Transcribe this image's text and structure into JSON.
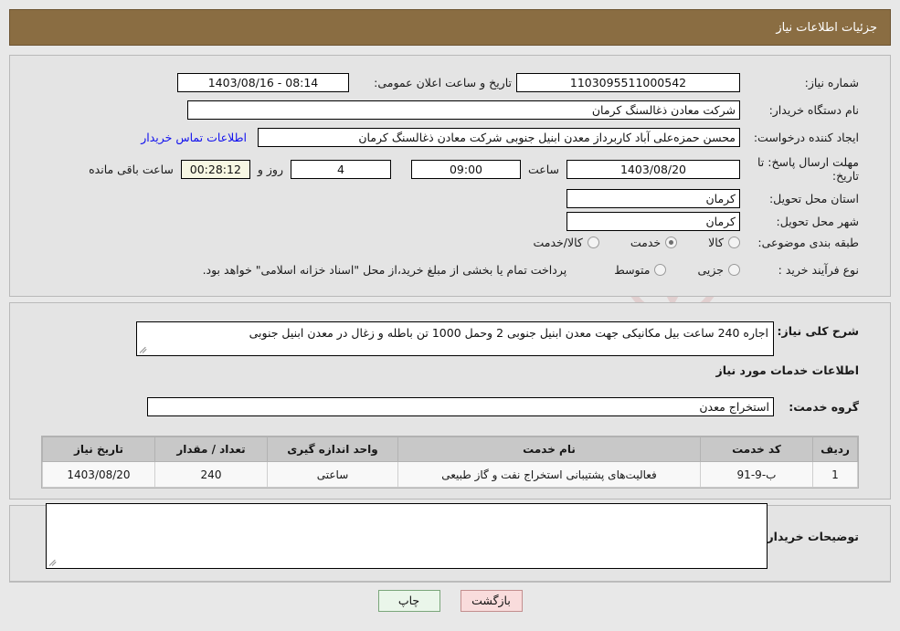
{
  "header": {
    "title": "جزئیات اطلاعات نیاز"
  },
  "watermark": {
    "text": "AriaTender.net"
  },
  "form": {
    "need_number_label": "شماره نیاز:",
    "need_number_value": "1103095511000542",
    "announce_label": "تاریخ و ساعت اعلان عمومی:",
    "announce_value": "1403/08/16 - 08:14",
    "buyer_org_label": "نام دستگاه خریدار:",
    "buyer_org_value": "شرکت معادن ذغالسنگ کرمان",
    "creator_label": "ایجاد کننده درخواست:",
    "creator_value": "محسن حمزه‌علی آباد کاربرداز معدن ابنیل جنوبی شرکت معادن ذغالسنگ کرمان",
    "contact_link": "اطلاعات تماس خریدار",
    "deadline_label": "مهلت ارسال پاسخ: تا تاریخ:",
    "deadline_date": "1403/08/20",
    "hour_label": "ساعت",
    "hour_value": "09:00",
    "days_value": "4",
    "days_label": "روز و",
    "countdown_value": "00:28:12",
    "countdown_label": "ساعت باقی مانده",
    "province_label": "استان محل تحویل:",
    "province_value": "کرمان",
    "city_label": "شهر محل تحویل:",
    "city_value": "کرمان",
    "category_label": "طبقه بندی موضوعی:",
    "category_options": [
      {
        "label": "کالا",
        "selected": false
      },
      {
        "label": "خدمت",
        "selected": true
      },
      {
        "label": "کالا/خدمت",
        "selected": false
      }
    ],
    "process_label": "نوع فرآیند خرید :",
    "process_options": [
      {
        "label": "جزیی",
        "selected": false
      },
      {
        "label": "متوسط",
        "selected": false
      }
    ],
    "payment_note": "پرداخت تمام یا بخشی از مبلغ خرید،از محل \"اسناد خزانه اسلامی\" خواهد بود."
  },
  "description": {
    "label": "شرح کلی نیاز:",
    "value": "اجاره 240 ساعت بیل مکانیکی جهت معدن ابنیل جنوبی  2 وحمل 1000 تن باطله و زغال در معدن ابنیل جنوبی"
  },
  "services": {
    "section_title": "اطلاعات خدمات مورد نیاز",
    "group_label": "گروه خدمت:",
    "group_value": "استخراج معدن",
    "table": {
      "columns": [
        "ردیف",
        "کد خدمت",
        "نام خدمت",
        "واحد اندازه گیری",
        "تعداد / مقدار",
        "تاریخ نیاز"
      ],
      "rows": [
        {
          "index": "1",
          "code": "ب-9-91",
          "name": "فعالیت‌های پشتیبانی استخراج نفت و گاز طبیعی",
          "unit": "ساعتی",
          "quantity": "240",
          "need_date": "1403/08/20"
        }
      ]
    }
  },
  "notes": {
    "label": "توضیحات خریدار:",
    "value": ""
  },
  "buttons": {
    "print": "چاپ",
    "back": "بازگشت"
  },
  "colors": {
    "header_bar": "#8a6d42",
    "link": "#1010ee",
    "print_bg": "#eaf6ea",
    "back_bg": "#f9dcdc",
    "table_head": "#c8c8c8"
  }
}
